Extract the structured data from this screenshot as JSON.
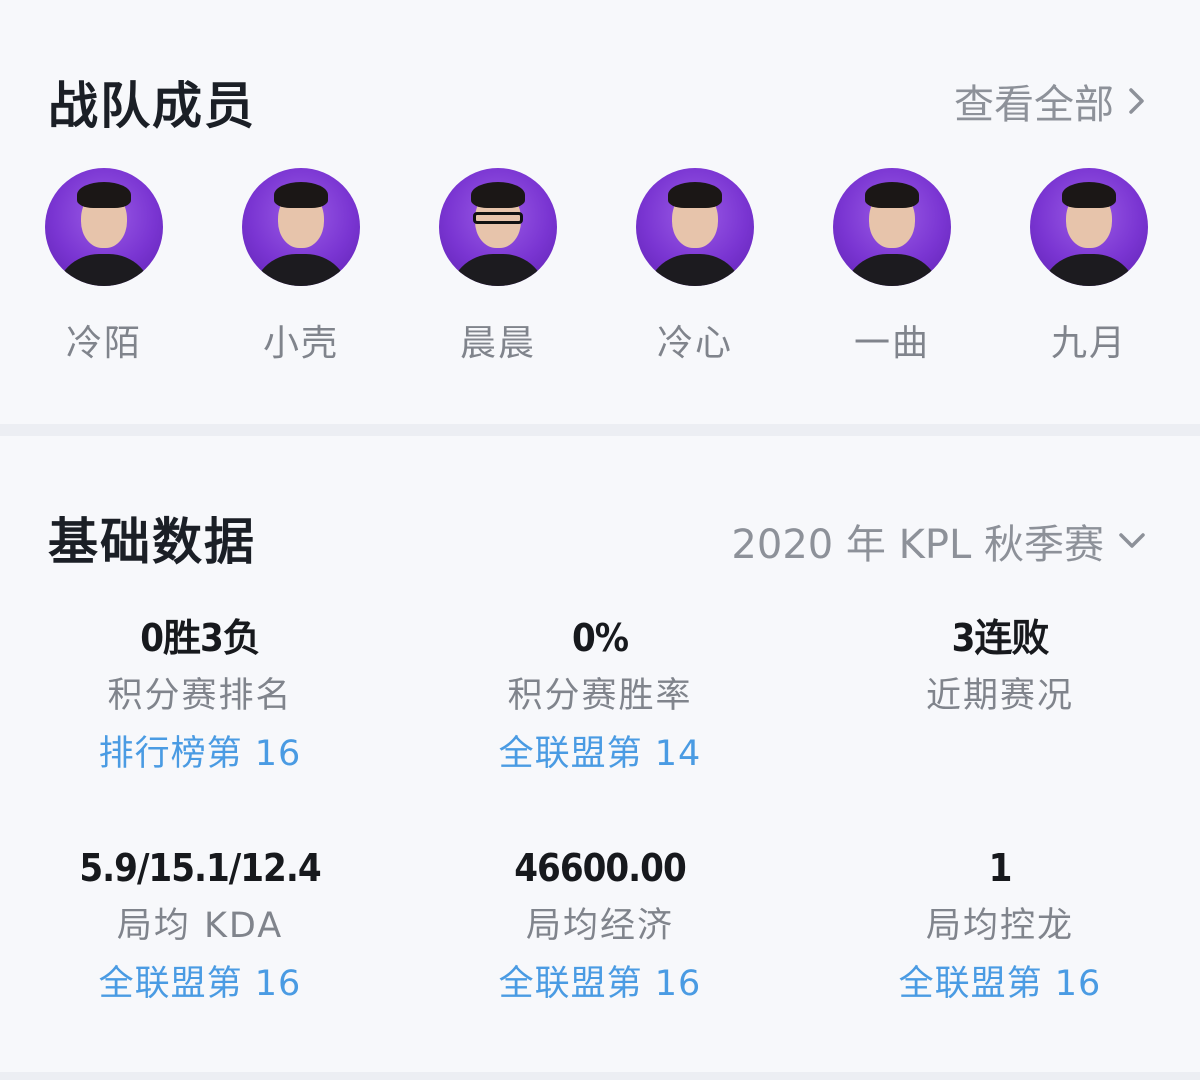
{
  "team_members": {
    "title": "战队成员",
    "view_all_label": "查看全部",
    "view_all_icon": "chevron-right-icon",
    "members": [
      {
        "name": "冷陌"
      },
      {
        "name": "小壳"
      },
      {
        "name": "晨晨"
      },
      {
        "name": "冷心"
      },
      {
        "name": "一曲"
      },
      {
        "name": "九月"
      }
    ]
  },
  "basic_stats": {
    "title": "基础数据",
    "season_selector": {
      "selected": "2020 年 KPL 秋季赛",
      "icon": "chevron-down-icon"
    },
    "stats": [
      {
        "value": "0胜3负",
        "label": "积分赛排名",
        "rank": "排行榜第 16"
      },
      {
        "value": "0%",
        "label": "积分赛胜率",
        "rank": "全联盟第 14"
      },
      {
        "value": "3连败",
        "label": "近期赛况",
        "rank": ""
      },
      {
        "value": "5.9/15.1/12.4",
        "label": "局均 KDA",
        "rank": "全联盟第 16"
      },
      {
        "value": "46600.00",
        "label": "局均经济",
        "rank": "全联盟第 16"
      },
      {
        "value": "1",
        "label": "局均控龙",
        "rank": "全联盟第 16"
      }
    ]
  },
  "colors": {
    "background": "#f7f8fb",
    "divider": "#eceef3",
    "title": "#1b1f26",
    "muted": "#80848c",
    "rank_link": "#4a9be3",
    "avatar_bg": "#7a35d2"
  }
}
